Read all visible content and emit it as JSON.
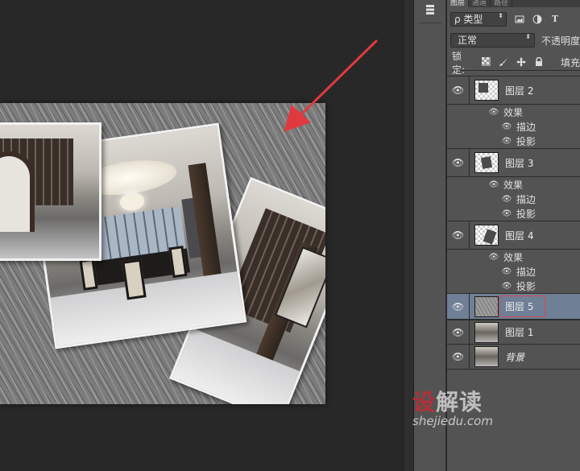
{
  "panel": {
    "tabs": [
      {
        "label": "图层",
        "active": true
      },
      {
        "label": "通道",
        "active": false
      },
      {
        "label": "路径",
        "active": false
      }
    ],
    "filter": {
      "label": "ρ 类型",
      "arrows": "⬍"
    },
    "filter_icons": [
      "image-filter-icon",
      "adjustment-filter-icon",
      "type-filter-icon"
    ],
    "type_icon_glyph": "T",
    "blend": {
      "label": "正常",
      "arrows": "⬍"
    },
    "opacity_label": "不透明度",
    "lock_label": "锁定:",
    "fill_label": "填充",
    "layers": [
      {
        "name": "图层 2",
        "effects_label": "效果",
        "effects": [
          "描边",
          "投影"
        ]
      },
      {
        "name": "图层 3",
        "effects_label": "效果",
        "effects": [
          "描边",
          "投影"
        ]
      },
      {
        "name": "图层 4",
        "effects_label": "效果",
        "effects": [
          "描边",
          "投影"
        ]
      },
      {
        "name": "图层 5",
        "selected": true
      },
      {
        "name": "图层 1"
      },
      {
        "name": "背景",
        "locked_italic": true
      }
    ]
  },
  "watermark": {
    "brand_red": "设",
    "brand_rest": "解读",
    "url": "shejiedu.com"
  },
  "colors": {
    "accent_selected": "#6f7f95",
    "highlight_box": "#d14a55",
    "arrow": "#e03a3e"
  }
}
